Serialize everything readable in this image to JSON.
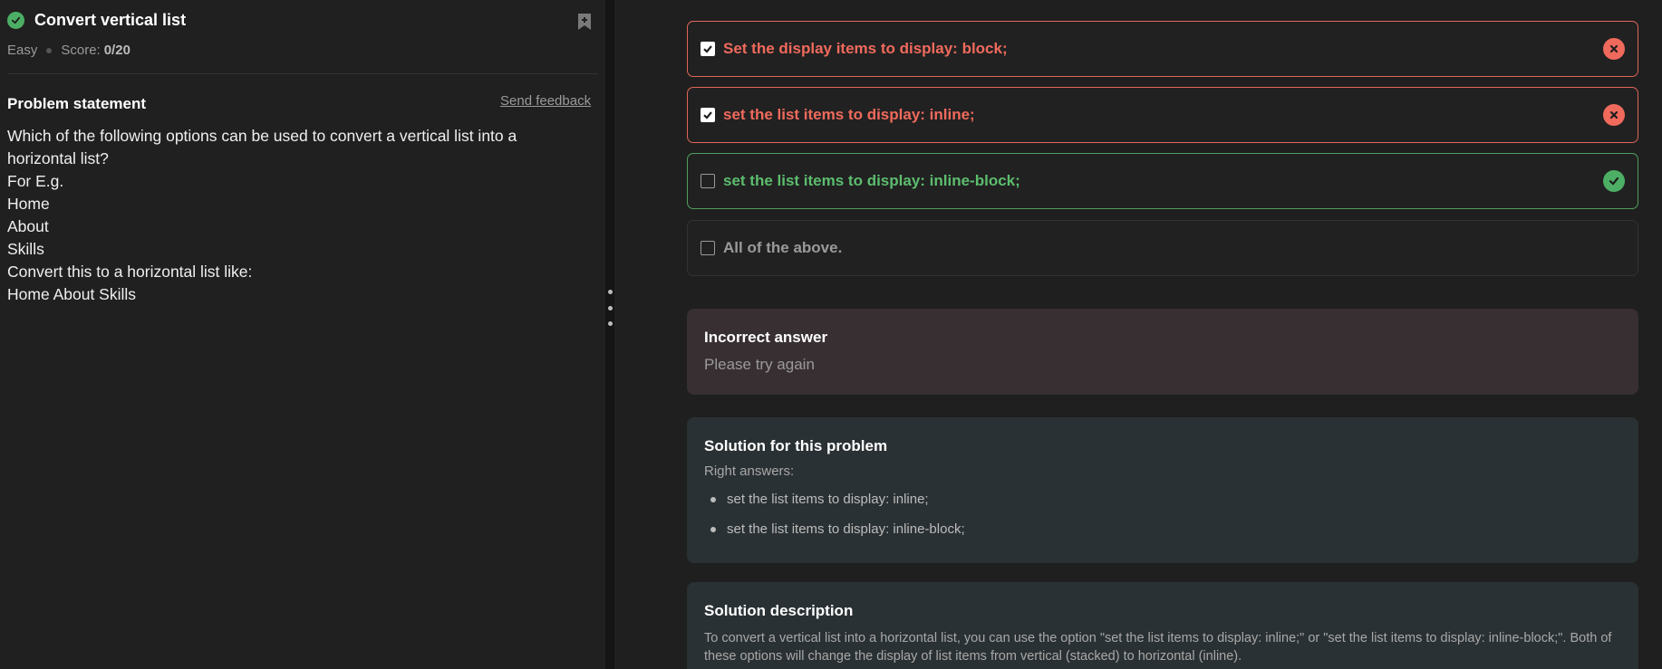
{
  "problem": {
    "title": "Convert vertical list",
    "difficulty": "Easy",
    "score_label": "Score:",
    "score_value": "0/20",
    "statement_heading": "Problem statement",
    "feedback_link": "Send feedback",
    "statement_lines": [
      "Which of the following options can be used to convert a vertical list into a",
      "horizontal list?",
      "For E.g.",
      "Home",
      "About",
      "Skills",
      "Convert this to a horizontal list like:",
      "Home About Skills"
    ]
  },
  "options": [
    {
      "label": "Set the display items to display: block;",
      "checked": true,
      "status": "wrong"
    },
    {
      "label": "set the list items to display: inline;",
      "checked": true,
      "status": "wrong"
    },
    {
      "label": "set the list items to display: inline-block;",
      "checked": false,
      "status": "correct"
    },
    {
      "label": "All of the above.",
      "checked": false,
      "status": "neutral"
    }
  ],
  "result": {
    "title": "Incorrect answer",
    "subtitle": "Please try again"
  },
  "solution": {
    "title": "Solution for this problem",
    "subtitle": "Right answers:",
    "answers": [
      "set the list items to display: inline;",
      "set the list items to display: inline-block;"
    ]
  },
  "description": {
    "title": "Solution description",
    "text": "To convert a vertical list into a horizontal list, you can use the option \"set the list items to display: inline;\" or \"set the list items to display: inline-block;\". Both of these options will change the display of list items from vertical (stacked) to horizontal (inline)."
  },
  "colors": {
    "wrong": "#f06a5c",
    "correct": "#5cbd6e",
    "neutral": "#9a9a9a"
  }
}
